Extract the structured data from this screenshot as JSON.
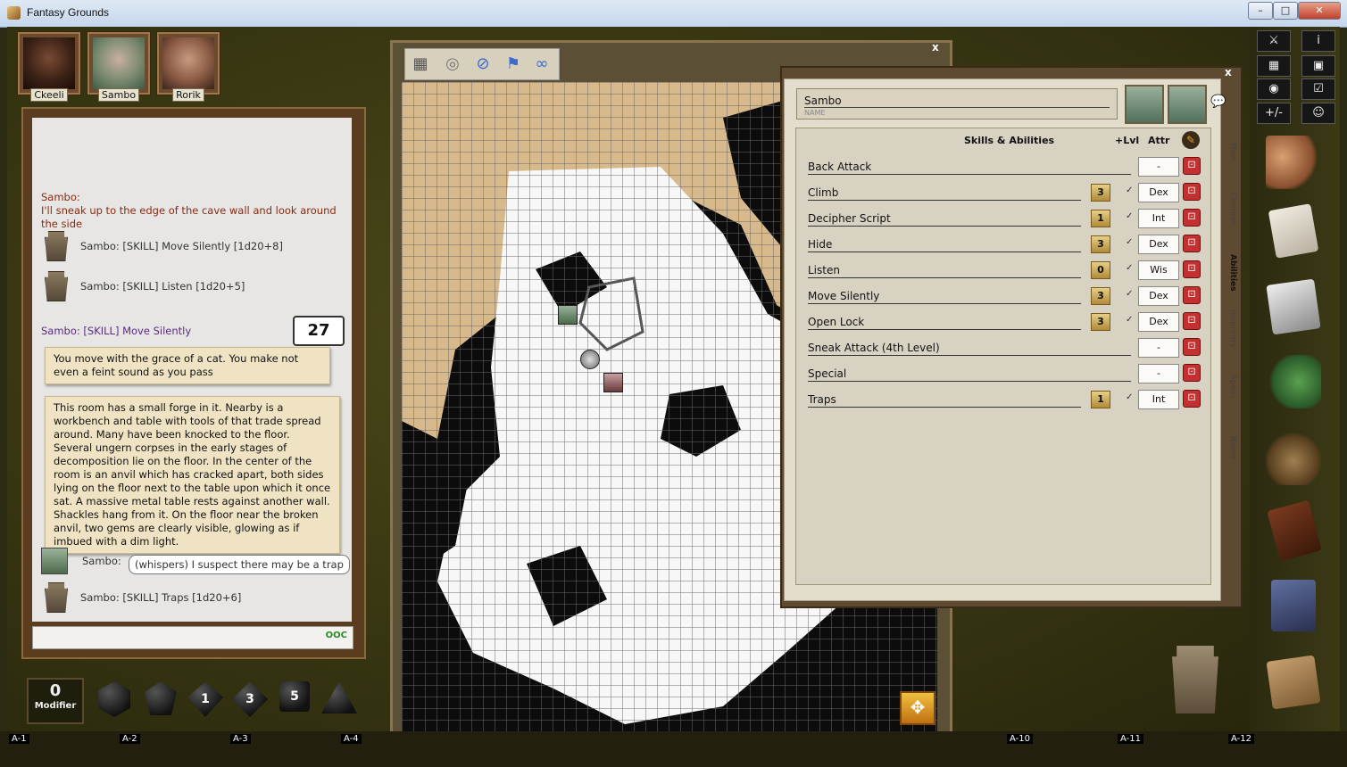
{
  "window": {
    "title": "Fantasy Grounds",
    "min": "–",
    "max": "□",
    "close": "✕"
  },
  "party": [
    {
      "name": "Ckeeli"
    },
    {
      "name": "Sambo"
    },
    {
      "name": "Rorik"
    }
  ],
  "chat": {
    "speaker_line": "Sambo:",
    "speech": "I'll sneak up to the edge of the cave wall and look around the side",
    "roll1": "Sambo:   [SKILL] Move Silently [1d20+8]",
    "roll2": "Sambo:   [SKILL] Listen [1d20+5]",
    "result_label": "Sambo:  [SKILL] Move Silently",
    "result_total": "27",
    "story1": "You move with the grace of a cat. You make not even a feint sound as you pass",
    "story2": "This room has a small forge in it. Nearby is a workbench and table with tools of that trade spread around. Many have been knocked to the floor. Several ungern corpses in the early stages of decomposition lie on the floor. In the center of the room is an anvil which has cracked apart, both sides lying on the floor next to the table upon which it once sat. A massive metal table rests against another wall. Shackles hang from it. On the floor near the broken anvil, two gems are clearly visible, glowing as if imbued with a dim light.",
    "whisper_speaker": "Sambo:",
    "whisper_text": "(whispers) I suspect there may be a trap",
    "roll3": "Sambo:   [SKILL] Traps [1d20+6]",
    "input_value": "",
    "ooc": "OOC"
  },
  "modifier": {
    "value": "0",
    "label": "Modifier"
  },
  "dice": [
    "d20",
    "d12",
    "d10",
    "d8",
    "d6",
    "d4"
  ],
  "dice_faces": [
    "",
    "",
    "1",
    "3",
    "5",
    ""
  ],
  "map": {
    "close": "x",
    "tools": [
      "grid",
      "target",
      "unmask",
      "flag",
      "link"
    ]
  },
  "sheet": {
    "close": "x",
    "name": "Sambo",
    "name_caption": "NAME",
    "section_title": "Skills & Abilities",
    "lvl_header": "+Lvl",
    "attr_header": "Attr",
    "skills": [
      {
        "name": "Back Attack",
        "lvl": "",
        "attr": "-"
      },
      {
        "name": "Climb",
        "lvl": "3",
        "attr": "Dex"
      },
      {
        "name": "Decipher Script",
        "lvl": "1",
        "attr": "Int"
      },
      {
        "name": "Hide",
        "lvl": "3",
        "attr": "Dex"
      },
      {
        "name": "Listen",
        "lvl": "0",
        "attr": "Wis"
      },
      {
        "name": "Move Silently",
        "lvl": "3",
        "attr": "Dex"
      },
      {
        "name": "Open Lock",
        "lvl": "3",
        "attr": "Dex"
      },
      {
        "name": "Sneak Attack (4th Level)",
        "lvl": "",
        "attr": "-"
      },
      {
        "name": "Special",
        "lvl": "",
        "attr": "-"
      },
      {
        "name": "Traps",
        "lvl": "1",
        "attr": "Int"
      }
    ],
    "tabs": [
      "Main",
      "Combat",
      "Abilities",
      "Inventory",
      "Spells",
      "Notes"
    ],
    "active_tab": "Abilities"
  },
  "right_bar": {
    "buttons": [
      "⚔",
      "i",
      "▦",
      "▣",
      "◉",
      "☑",
      "+/-",
      "☺"
    ]
  },
  "ruler": [
    "A-1",
    "A-2",
    "A-3",
    "A-4",
    "A-10",
    "A-11",
    "A-12"
  ]
}
